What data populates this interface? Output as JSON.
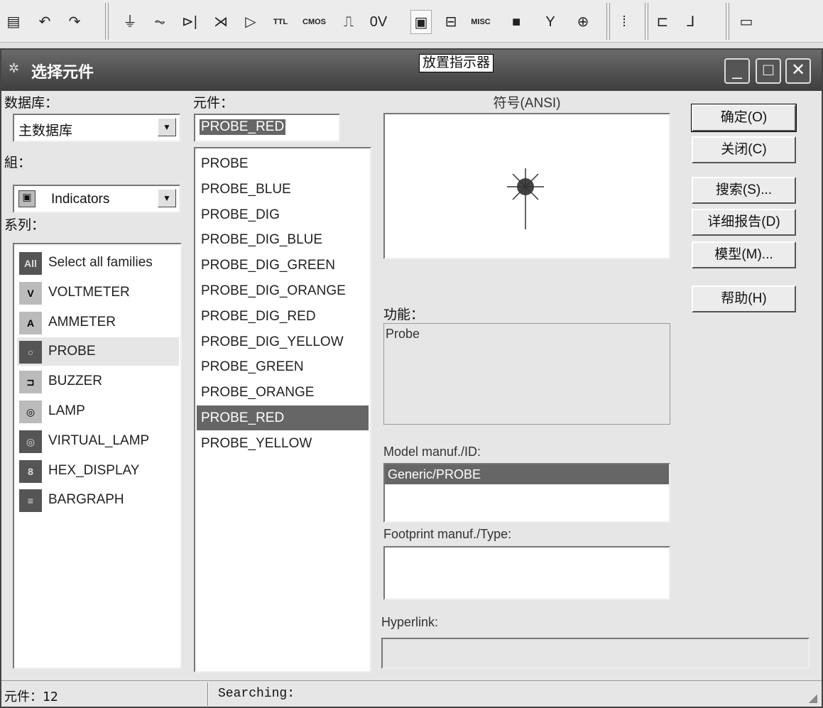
{
  "toolbar": {
    "items": [
      {
        "name": "paste-icon",
        "glyph": "▤"
      },
      {
        "name": "undo-icon",
        "glyph": "↶"
      },
      {
        "name": "redo-icon",
        "glyph": "↷"
      },
      {
        "name": "source-icon",
        "glyph": "⏚"
      },
      {
        "name": "basic-icon",
        "glyph": "⏦"
      },
      {
        "name": "diode-icon",
        "glyph": "⊳|"
      },
      {
        "name": "transistor-icon",
        "glyph": "⋊"
      },
      {
        "name": "analog-icon",
        "glyph": "▷"
      },
      {
        "name": "ttl-icon",
        "glyph": "TTL"
      },
      {
        "name": "cmos-icon",
        "glyph": "CMOS"
      },
      {
        "name": "mcu-icon",
        "glyph": "⎍"
      },
      {
        "name": "mixed-icon",
        "glyph": "0V"
      },
      {
        "name": "indicator-icon",
        "glyph": "▣"
      },
      {
        "name": "power-icon",
        "glyph": "⊟"
      },
      {
        "name": "misc-icon",
        "glyph": "MISC"
      },
      {
        "name": "advanced-peripherals-icon",
        "glyph": "■"
      },
      {
        "name": "rf-icon",
        "glyph": "Y"
      },
      {
        "name": "electromechanical-icon",
        "glyph": "⊕"
      },
      {
        "name": "ladder-icon",
        "glyph": "⁞"
      },
      {
        "name": "hierarchical-icon",
        "glyph": "⊏"
      },
      {
        "name": "bus-icon",
        "glyph": "⅃"
      },
      {
        "name": "instrument-icon",
        "glyph": "▭"
      }
    ]
  },
  "tooltip": "放置指示器",
  "dialog": {
    "title": "选择元件",
    "database_label": "数据库：",
    "database_value": "主数据库",
    "group_label": "組：",
    "group_value": "Indicators",
    "family_label": "系列：",
    "families": [
      {
        "label": "Select all families",
        "icon": "All"
      },
      {
        "label": "VOLTMETER",
        "icon": "V"
      },
      {
        "label": "AMMETER",
        "icon": "A"
      },
      {
        "label": "PROBE",
        "icon": "○"
      },
      {
        "label": "BUZZER",
        "icon": "⊐"
      },
      {
        "label": "LAMP",
        "icon": "◎"
      },
      {
        "label": "VIRTUAL_LAMP",
        "icon": "◎"
      },
      {
        "label": "HEX_DISPLAY",
        "icon": "8"
      },
      {
        "label": "BARGRAPH",
        "icon": "≡"
      }
    ],
    "component_label": "元件：",
    "component_value": "PROBE_RED",
    "components": [
      "PROBE",
      "PROBE_BLUE",
      "PROBE_DIG",
      "PROBE_DIG_BLUE",
      "PROBE_DIG_GREEN",
      "PROBE_DIG_ORANGE",
      "PROBE_DIG_RED",
      "PROBE_DIG_YELLOW",
      "PROBE_GREEN",
      "PROBE_ORANGE",
      "PROBE_RED",
      "PROBE_YELLOW"
    ],
    "symbol_label": "符号(ANSI)",
    "function_label": "功能：",
    "function_value": "Probe",
    "model_label": "Model manuf./ID:",
    "model_value": "Generic/PROBE",
    "footprint_label": "Footprint manuf./Type:",
    "hyperlink_label": "Hyperlink:",
    "buttons": {
      "ok": "确定(O)",
      "close": "关闭(C)",
      "search": "搜索(S)...",
      "detail": "详细报告(D)",
      "model": "模型(M)...",
      "help": "帮助(H)"
    },
    "status_count": "元件：12",
    "status_search": "Searching:"
  }
}
